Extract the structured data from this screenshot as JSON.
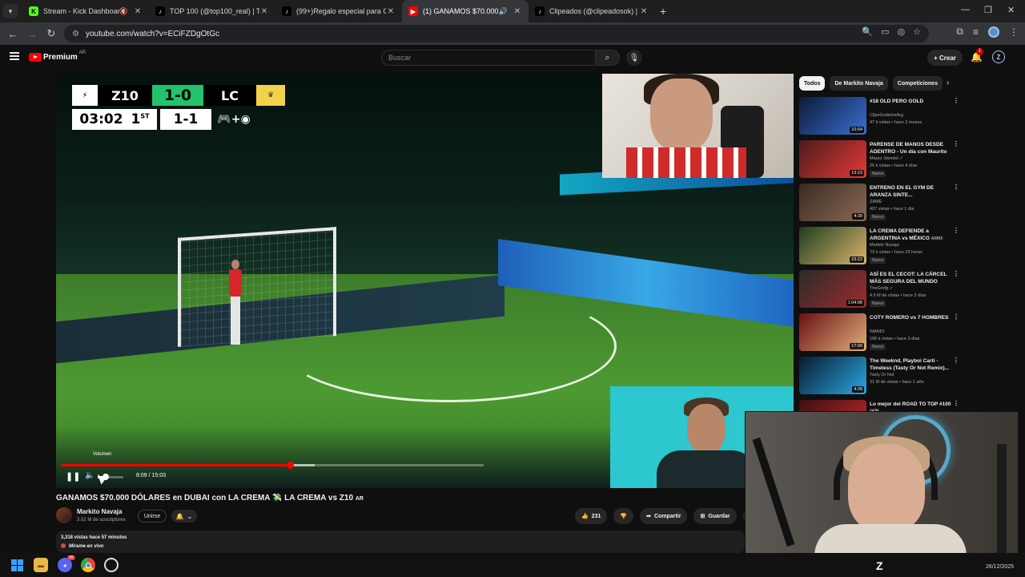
{
  "browser": {
    "tabs": [
      {
        "label": "Stream - Kick Dashboard",
        "favicon": "kick-icon",
        "audio": "muted"
      },
      {
        "label": "TOP 100 (@top100_real) | TikTok",
        "favicon": "tiktok-icon"
      },
      {
        "label": "(99+)Regalo especial para Cos",
        "favicon": "tiktok-icon"
      },
      {
        "label": "(1) GANAMOS $70.000 DÓ",
        "favicon": "youtube-icon",
        "audio": "playing",
        "active": true
      },
      {
        "label": "Clipeados (@clipeadosok) | TikT",
        "favicon": "tiktok-icon"
      }
    ],
    "url": "youtube.com/watch?v=ECiFZDgOtGc"
  },
  "masthead": {
    "logo_text": "Premium",
    "region": "AR",
    "search_placeholder": "Buscar",
    "create_label": "Crear",
    "notif_count": "1",
    "avatar_letter": "Z"
  },
  "scoreboard": {
    "team_home": "Z10",
    "score": "1-0",
    "team_away": "LC",
    "clock": "03:02",
    "period": "1",
    "period_suffix": "ST",
    "aggregate": "1-1"
  },
  "player": {
    "tooltip": "Volumen",
    "current_time": "8:09",
    "duration": "15:03",
    "progress": 0.542,
    "buffered": 0.6,
    "volume": 0.3
  },
  "video": {
    "title": "GANAMOS $70.000 DÓLARES en DUBAI con LA CREMA 💸 LA CREMA vs Z10",
    "title_flag": "AR",
    "channel": "Markito Navaja",
    "subscribers": "3.02 M de suscriptores",
    "join_label": "Unirse",
    "likes": "231",
    "share_label": "Compartir",
    "save_label": "Guardar",
    "views_meta": "3,318 vistas  hace 57 minutos",
    "live_note": "Mírame en vivo"
  },
  "sidebar": {
    "chips": [
      "Todos",
      "De Markito Navaja",
      "Competiciones"
    ],
    "items": [
      {
        "title": "#18 OLD PERO GOLD",
        "channel": "ClipeGodetosArg",
        "stats": "47 k vistas • hace 2 meses",
        "duration": "10:04",
        "new": "",
        "colors": [
          "#0d1a3a",
          "#3a6fd0"
        ]
      },
      {
        "title": "PARENSE DE MANOS DESDE ADENTRO - Un día con Maurito",
        "channel": "Mauro Stendel ✓",
        "stats": "26 k vistas • hace 4 días",
        "duration": "13:23",
        "new": "Nuevo",
        "colors": [
          "#4b1c1c",
          "#e53935"
        ]
      },
      {
        "title": "ENTRENO EN EL GYM DE ARANZA SINTE...",
        "channel": "ZAME",
        "stats": "407 vistas • hace 1 día",
        "duration": "4:39",
        "new": "Nuevo",
        "colors": [
          "#3a2a22",
          "#8a6a55"
        ]
      },
      {
        "title": "LA CREMA DEFIENDE a ARGENTINA vs MÉXICO",
        "channel": "Markito Navaja",
        "stats": "73 k vistas • hace 23 horas",
        "duration": "23:22",
        "new": "Nuevo",
        "colors": [
          "#1f3d1f",
          "#d9b36b"
        ],
        "badge": "ARMX"
      },
      {
        "title": "ASÍ ES EL CECOT: LA CÁRCEL MÁS SEGURA DEL MUNDO",
        "channel": "TheGrefg ✓",
        "stats": "4.5 M de vistas • hace 3 días",
        "duration": "1:04:08",
        "new": "Nuevo",
        "colors": [
          "#2b2b2b",
          "#9e2b2b"
        ]
      },
      {
        "title": "COTY ROMERO vs 7 HOMBRES",
        "channel": "WANDI",
        "stats": "196 k vistas • hace 3 días",
        "duration": "17:00",
        "new": "Nuevo",
        "colors": [
          "#6b0f13",
          "#e0b07a"
        ]
      },
      {
        "title": "The Weeknd, Playboi Carti - Timeless (Tasty Or Not Remix)...",
        "channel": "Tasty Or Not",
        "stats": "31 M de vistas • hace 1 año",
        "duration": "4:28",
        "new": "",
        "colors": [
          "#0a1a30",
          "#2aa7e0"
        ]
      },
      {
        "title": "Lo mejor del ROAD TO TOP #100 (#2)",
        "channel": "",
        "stats": "",
        "duration": "",
        "new": "",
        "colors": [
          "#3a1010",
          "#c62828"
        ]
      }
    ]
  },
  "taskbar": {
    "date": "26/12/2025",
    "discord_badge": "99"
  }
}
